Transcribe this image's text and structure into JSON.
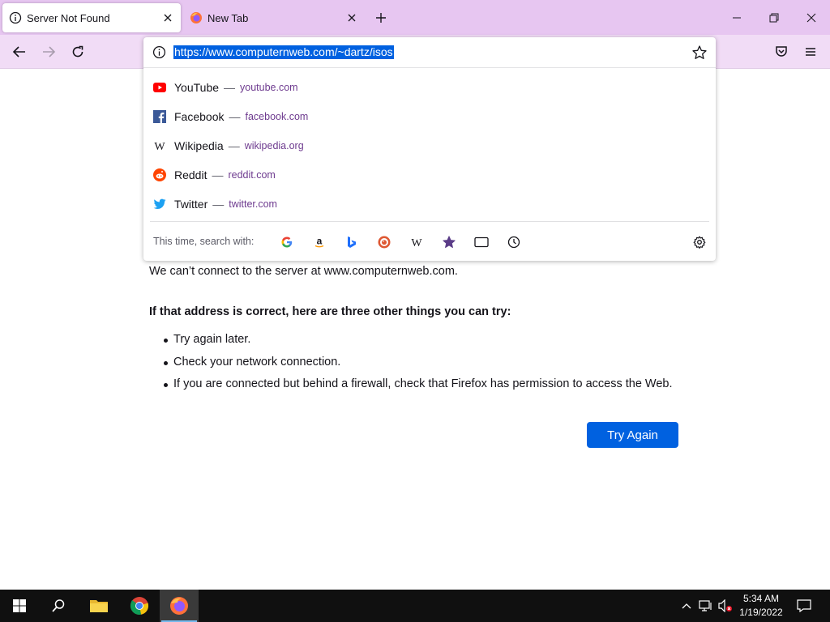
{
  "tabs": [
    {
      "title": "Server Not Found",
      "icon": "info-icon",
      "active": true
    },
    {
      "title": "New Tab",
      "icon": "firefox-icon",
      "active": false
    }
  ],
  "urlbar": {
    "url": "https://www.computernweb.com/~dartz/isos"
  },
  "suggestions": [
    {
      "title": "YouTube",
      "url": "youtube.com",
      "icon": "youtube-icon"
    },
    {
      "title": "Facebook",
      "url": "facebook.com",
      "icon": "facebook-icon"
    },
    {
      "title": "Wikipedia",
      "url": "wikipedia.org",
      "icon": "wikipedia-icon"
    },
    {
      "title": "Reddit",
      "url": "reddit.com",
      "icon": "reddit-icon"
    },
    {
      "title": "Twitter",
      "url": "twitter.com",
      "icon": "twitter-icon"
    }
  ],
  "separator": "—",
  "search_with_label": "This time, search with:",
  "search_engines": [
    "google-icon",
    "amazon-icon",
    "bing-icon",
    "duckduckgo-icon",
    "wikipedia-icon",
    "bookmarks-icon",
    "tabs-icon",
    "history-icon",
    "settings-icon"
  ],
  "error_page": {
    "description": "We can’t connect to the server at www.computernweb.com.",
    "subheading": "If that address is correct, here are three other things you can try:",
    "tips": [
      "Try again later.",
      "Check your network connection.",
      "If you are connected but behind a firewall, check that Firefox has permission to access the Web."
    ],
    "button": "Try Again"
  },
  "taskbar": {
    "time": "5:34 AM",
    "date": "1/19/2022"
  },
  "colors": {
    "tabstrip": "#e7c6f1",
    "navbar": "#f1dcf6",
    "accent": "#0061e0",
    "taskbar": "#101010"
  }
}
